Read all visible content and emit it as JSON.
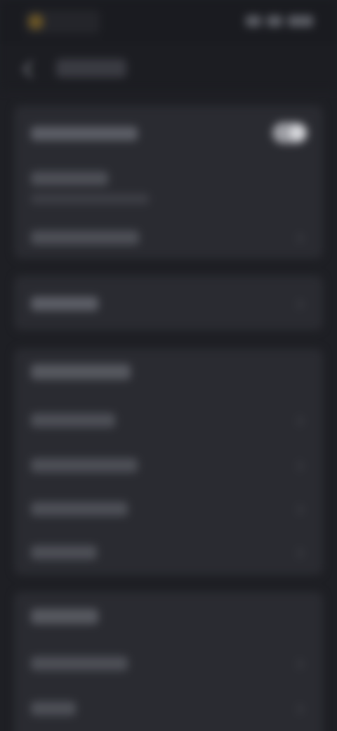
{
  "status_bar": {
    "logo_icon": "app-logo-icon",
    "icons": [
      "signal-icon",
      "wifi-icon",
      "battery-icon"
    ]
  },
  "header": {
    "back_icon": "chevron-left-icon",
    "title": ""
  },
  "sections": [
    {
      "id": "section-1",
      "rows": [
        {
          "label": "",
          "control": "toggle",
          "on": true
        },
        {
          "label": "",
          "sublabel": "",
          "control": "none"
        },
        {
          "label": "",
          "control": "chevron"
        }
      ]
    },
    {
      "id": "section-2",
      "rows": [
        {
          "label": "",
          "control": "chevron"
        }
      ]
    },
    {
      "id": "section-3",
      "header": "",
      "rows": [
        {
          "label": "",
          "control": "chevron"
        },
        {
          "label": "",
          "control": "chevron"
        },
        {
          "label": "",
          "control": "chevron"
        },
        {
          "label": "",
          "control": "chevron"
        }
      ]
    },
    {
      "id": "section-4",
      "header": "",
      "rows": [
        {
          "label": "",
          "control": "chevron"
        },
        {
          "label": "",
          "control": "chevron"
        }
      ]
    }
  ],
  "colors": {
    "background": "#1e1f24",
    "card": "#2a2b31",
    "accent_logo": "#6a5526",
    "toggle_on": "#9d9ea4"
  }
}
